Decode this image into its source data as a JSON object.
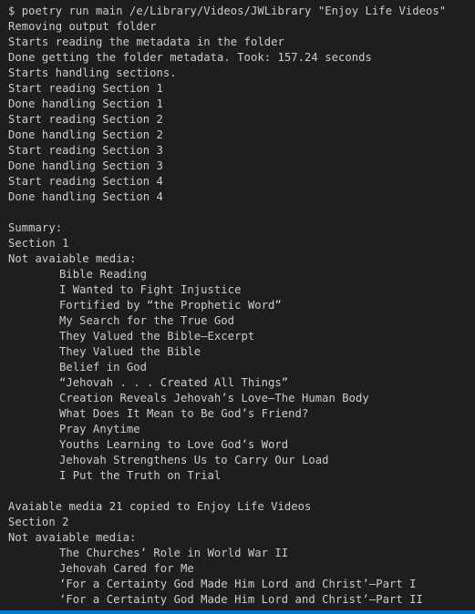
{
  "terminal": {
    "command": "$ poetry run main /e/Library/Videos/JWLibrary \"Enjoy Life Videos\"",
    "log": [
      "Removing output folder",
      "Starts reading the metadata in the folder",
      "Done getting the folder metadata. Took: 157.24 seconds",
      "Starts handling sections.",
      "Start reading Section 1",
      "Done handling Section 1",
      "Start reading Section 2",
      "Done handling Section 2",
      "Start reading Section 3",
      "Done handling Section 3",
      "Start reading Section 4",
      "Done handling Section 4"
    ],
    "summary_label": "Summary:",
    "section1": {
      "title": "Section 1",
      "not_available_label": "Not avaiable media:",
      "items": [
        "Bible Reading",
        "I Wanted to Fight Injustice",
        "Fortified by “the Prophetic Word”",
        "My Search for the True God",
        "They Valued the Bible—Excerpt",
        "They Valued the Bible",
        "Belief in God",
        "“Jehovah . . . Created All Things”",
        "Creation Reveals Jehovah’s Love—The Human Body",
        "What Does It Mean to Be God’s Friend?",
        "Pray Anytime",
        "Youths Learning to Love God’s Word",
        "Jehovah Strengthens Us to Carry Our Load",
        "I Put the Truth on Trial"
      ],
      "copied_text": "Avaiable media 21 copied to Enjoy Life Videos"
    },
    "section2": {
      "title": "Section 2",
      "not_available_label": "Not avaiable media:",
      "items": [
        "The Churches’ Role in World War II",
        "Jehovah Cared for Me",
        "‘For a Certainty God Made Him Lord and Christ’—Part I",
        "‘For a Certainty God Made Him Lord and Christ’—Part II"
      ]
    },
    "colors": {
      "background": "#1e1e1e",
      "foreground": "#cccccc",
      "accent": "#007acc"
    }
  }
}
